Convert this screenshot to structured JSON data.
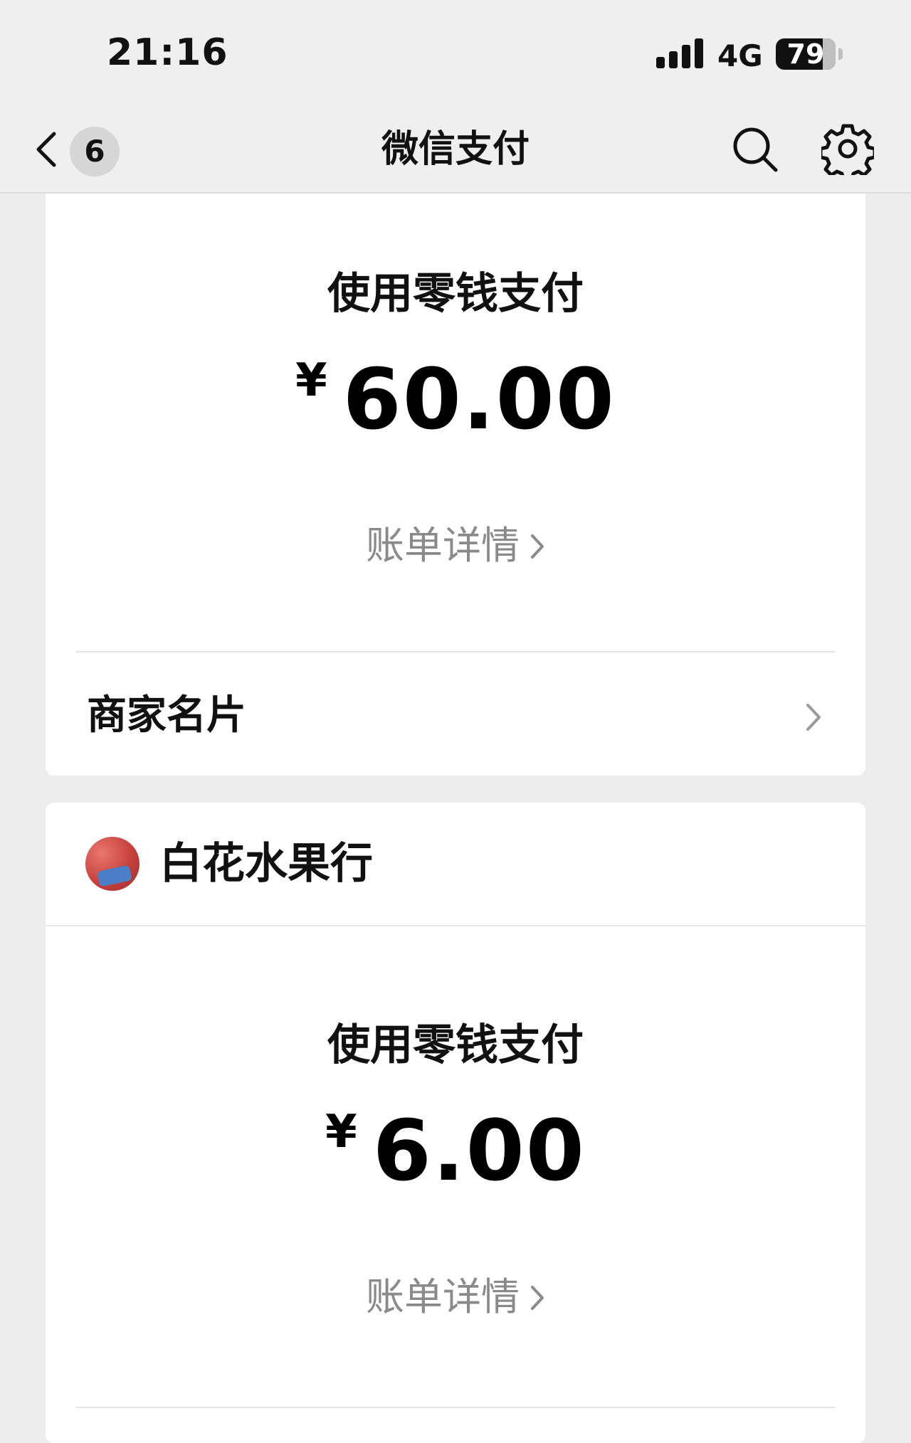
{
  "status_bar": {
    "time": "21:16",
    "network": "4G",
    "battery": "79",
    "battery_level": 0.79
  },
  "nav": {
    "unread_count": "6",
    "title": "微信支付"
  },
  "transactions": [
    {
      "method": "使用零钱支付",
      "currency": "¥",
      "amount": "60.00",
      "bill_link": "账单详情",
      "merchant_card": "商家名片"
    },
    {
      "shop_name": "白花水果行",
      "method": "使用零钱支付",
      "currency": "¥",
      "amount": "6.00",
      "bill_link": "账单详情"
    }
  ],
  "colors": {
    "background": "#ededed",
    "card": "#ffffff",
    "muted_text": "#8a8a8a"
  },
  "icons": [
    "back-chevron-icon",
    "search-icon",
    "gear-icon",
    "chevron-right-icon"
  ]
}
